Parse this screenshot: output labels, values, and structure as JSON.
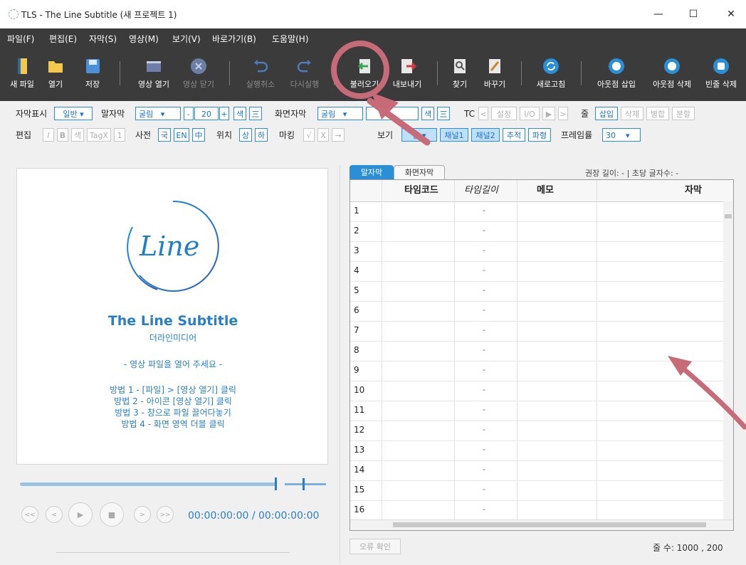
{
  "window": {
    "title": "TLS - The Line Subtitle (새 프로젝트 1)",
    "minimize": "—",
    "maximize": "☐",
    "close": "✕"
  },
  "menu": [
    "파일(F)",
    "편집(E)",
    "자막(S)",
    "영상(M)",
    "보기(V)",
    "바로가기(B)",
    "도움말(H)"
  ],
  "toolbar": {
    "new": "새 파일",
    "open": "열기",
    "save": "저장",
    "video_open": "영상 열기",
    "video_close": "영상 닫기",
    "undo": "실행취소",
    "redo": "다시실행",
    "import": "불러오기",
    "export": "내보내기",
    "find": "찾기",
    "replace": "바꾸기",
    "refresh": "새로고침",
    "outpoint_insert": "아웃점 삽입",
    "outpoint_delete": "아웃점 삭제",
    "blank_delete": "빈줄 삭제"
  },
  "row1": {
    "display_label": "자막표시",
    "display_value": "일반",
    "speech_label": "말자막",
    "speech_font": "굴림",
    "minus": "-",
    "size": "20",
    "plus": "+",
    "color": "색",
    "align": "三",
    "screen_label": "화면자막",
    "screen_font": "굴림",
    "color2": "색",
    "align2": "三",
    "tc_label": "TC",
    "tc_prev": "<",
    "tc_set": "설정",
    "tc_io": "I/O",
    "tc_play": "▶",
    "tc_next": ">",
    "line_label": "줄",
    "insert": "삽입",
    "delete": "삭제",
    "merge": "병합",
    "split": "분할"
  },
  "row2": {
    "edit_label": "편집",
    "italic": "I",
    "bold": "B",
    "color": "색",
    "tagx": "TagX",
    "one": "1",
    "dict_label": "사전",
    "ko": "국",
    "en": "EN",
    "zh": "中",
    "pos_label": "위치",
    "top": "상",
    "bottom": "하",
    "mark_label": "마킹",
    "check": "√",
    "x": "X",
    "arrow": "→",
    "view_label": "보기",
    "view_value": "통",
    "ch1": "채널1",
    "ch2": "채널2",
    "track": "추적",
    "wave": "파형",
    "fps_label": "프레임률",
    "fps": "30"
  },
  "player": {
    "brand_script": "Line",
    "brand": "The Line Subtitle",
    "company": "더라인미디어",
    "prompt": "- 영상 파일을 열어 주세요 -",
    "methods": [
      "방법 1 - [파일] > [영상 열기] 클릭",
      "방법 2 - 아이콘 [영상 열기] 클릭",
      "방법 3 - 창으로 파일 끌어다놓기",
      "방법 4 - 화면 영역 더블 클릭"
    ],
    "controls": [
      "<<",
      "<",
      "▶",
      "■",
      ">",
      ">>"
    ],
    "timecode": "00:00:00:00 / 00:00:00:00",
    "progress": 0
  },
  "tabs": {
    "speech": "말자막",
    "screen": "화면자막"
  },
  "recommend": "권장 길이:  -   |   초당 글자수:  -",
  "grid": {
    "headers": {
      "timecode": "타임코드",
      "length": "타임길이",
      "memo": "메모",
      "subtitle": "자막"
    },
    "rows": [
      "1",
      "2",
      "3",
      "4",
      "5",
      "6",
      "7",
      "8",
      "9",
      "10",
      "11",
      "12",
      "13",
      "14",
      "15",
      "16"
    ],
    "dash": "-"
  },
  "err_button": "오류 확인",
  "status": "줄 수:  1000 ,  200",
  "colors": {
    "accent": "#2a8fd6",
    "dark": "#3b3b3b",
    "arrow": "#c86b78"
  }
}
